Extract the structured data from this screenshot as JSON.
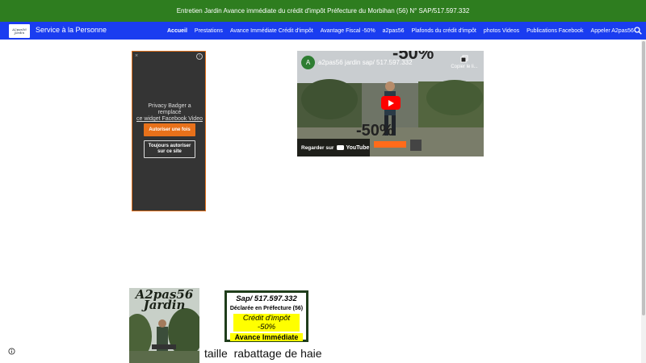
{
  "banner": {
    "text": "Entretien Jardin Avance immédiate du crédit d'impôt Préfecture du Morbihan (56) N° SAP/517.597.332"
  },
  "header": {
    "logo_text": "A2pas56 Jardin",
    "site_title": "Service à la Personne",
    "nav": [
      "Accueil",
      "Prestations",
      "Avance Immédiate Crédit d'impôt",
      "Avantage Fiscal -50%",
      "a2pas56",
      "Plafonds du crédit d'impôt",
      "photos Videos",
      "Publications Facebook",
      "Appeler A2pas56"
    ],
    "active_nav": "Accueil",
    "icons": {
      "search": "search-icon"
    }
  },
  "facebook_placeholder": {
    "close": "×",
    "info": "i",
    "message_line1": "Privacy Badger a remplacé",
    "message_line2": "ce widget Facebook Video",
    "allow_once": "Autoriser une fois",
    "allow_always": "Toujours autoriser sur ce site",
    "colors": {
      "accent": "#e8711a",
      "background": "#343434"
    }
  },
  "youtube": {
    "channel_initial": "A",
    "title": "a2pas56 jardin sap/ 517.597.332",
    "copy_label": "Copier le li...",
    "overlay_big": "-50%",
    "watch_on": "Regarder sur",
    "youtube_brand": "YouTube"
  },
  "content": {
    "picture_title_line1": "A2pas56",
    "picture_title_line2": "Jardin",
    "sign": {
      "line1": "Sap/ 517.597.332",
      "line2": "Déclarée en Préfecture (56)",
      "line3": "Crédit d'impôt -50%",
      "line4": "Avance Immédiate"
    },
    "heading": "taille  rabattage de haie"
  },
  "colors": {
    "banner": "#2e7d1f",
    "navbar": "#1a3df0"
  }
}
